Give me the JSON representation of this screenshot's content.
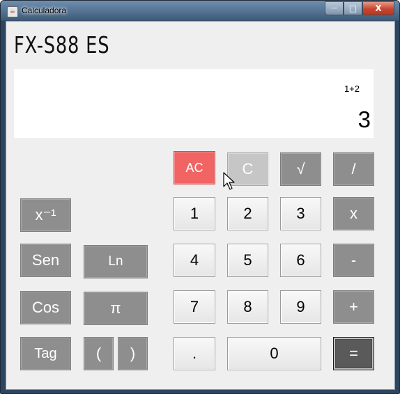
{
  "window": {
    "title": "Calculadora",
    "icon": "java-cup-icon",
    "controls": {
      "minimize": "—",
      "maximize": "□",
      "close": "X"
    }
  },
  "calculator": {
    "model": "FX-S88 ES",
    "expression": "1+2",
    "result": "3"
  },
  "buttons": {
    "ac": "AC",
    "c": "C",
    "sqrt": "√",
    "divide": "/",
    "inverse": "x⁻¹",
    "sen": "Sen",
    "ln": "Ln",
    "cos": "Cos",
    "pi": "π",
    "tag": "Tag",
    "lparen": "(",
    "rparen": ")",
    "d1": "1",
    "d2": "2",
    "d3": "3",
    "multiply": "x",
    "d4": "4",
    "d5": "5",
    "d6": "6",
    "minus": "-",
    "d7": "7",
    "d8": "8",
    "d9": "9",
    "plus": "+",
    "dot": ".",
    "d0": "0",
    "equals": "="
  },
  "colors": {
    "ac": "#f06464",
    "c": "#c6c6c6",
    "function": "#8e8e8e",
    "digit": "#f0f0f0",
    "equals": "#5a5a5a",
    "display": "#ffffff"
  }
}
